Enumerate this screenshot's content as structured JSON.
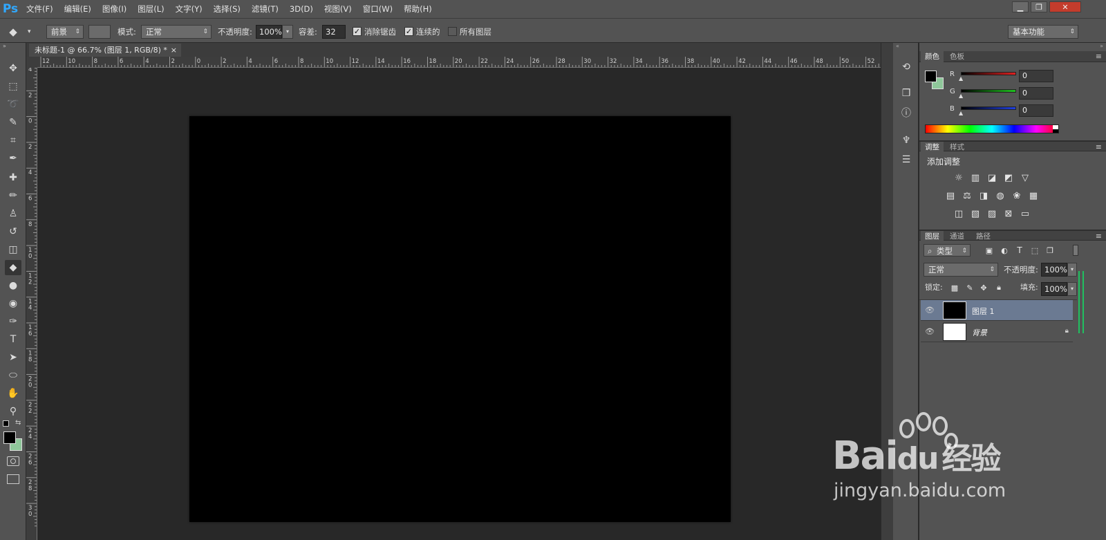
{
  "app": {
    "logo": "Ps"
  },
  "menu": [
    "文件(F)",
    "编辑(E)",
    "图像(I)",
    "图层(L)",
    "文字(Y)",
    "选择(S)",
    "滤镜(T)",
    "3D(D)",
    "视图(V)",
    "窗口(W)",
    "帮助(H)"
  ],
  "window_controls": {
    "minimize": "▁",
    "restore": "❐",
    "close": "✕"
  },
  "options": {
    "fill_source": "前景",
    "mode_label": "模式:",
    "mode_value": "正常",
    "opacity_label": "不透明度:",
    "opacity_value": "100%",
    "tolerance_label": "容差:",
    "tolerance_value": "32",
    "antialias_label": "消除锯齿",
    "contiguous_label": "连续的",
    "all_layers_label": "所有图层",
    "antialias_checked": true,
    "contiguous_checked": true,
    "all_layers_checked": false,
    "workspace": "基本功能"
  },
  "document": {
    "tab_title": "未标题-1 @ 66.7% (图层 1, RGB/8) *",
    "close": "×"
  },
  "ruler_h": [
    "12",
    "10",
    "8",
    "6",
    "4",
    "2",
    "0",
    "2",
    "4",
    "6",
    "8",
    "10",
    "12",
    "14",
    "16",
    "18",
    "20",
    "22",
    "24",
    "26",
    "28",
    "30",
    "32",
    "34",
    "36",
    "38",
    "40",
    "42",
    "44",
    "46",
    "48",
    "50",
    "52"
  ],
  "ruler_v": [
    "4",
    "2",
    "0",
    "2",
    "4",
    "6",
    "8",
    "1 0",
    "1 2",
    "1 4",
    "1 6",
    "1 8",
    "2 0",
    "2 2",
    "2 4",
    "2 6",
    "2 8",
    "3 0"
  ],
  "tools": [
    "move-tool",
    "marquee-tool",
    "lasso-tool",
    "quick-select-tool",
    "crop-tool",
    "eyedropper-tool",
    "healing-tool",
    "brush-tool",
    "stamp-tool",
    "history-brush-tool",
    "eraser-tool",
    "paint-bucket-tool",
    "blur-tool",
    "dodge-tool",
    "pen-tool",
    "type-tool",
    "path-select-tool",
    "ellipse-tool",
    "hand-tool",
    "zoom-tool"
  ],
  "colors": {
    "foreground": "#000000",
    "background": "#8fc79a",
    "accent": "#30a8ff"
  },
  "color_panel": {
    "tabs": [
      "颜色",
      "色板"
    ],
    "channels": [
      {
        "label": "R",
        "value": "0",
        "color": "#e02020"
      },
      {
        "label": "G",
        "value": "0",
        "color": "#20c020"
      },
      {
        "label": "B",
        "value": "0",
        "color": "#2040e0"
      }
    ]
  },
  "adjust_panel": {
    "tabs": [
      "调整",
      "样式"
    ],
    "title": "添加调整"
  },
  "layers_panel": {
    "tabs": [
      "图层",
      "通道",
      "路径"
    ],
    "filter_kind": "类型",
    "blend_mode": "正常",
    "opacity_label": "不透明度:",
    "opacity_value": "100%",
    "lock_label": "锁定:",
    "fill_label": "填充:",
    "fill_value": "100%",
    "layers": [
      {
        "name": "图层 1",
        "selected": true,
        "thumb": "#000000"
      },
      {
        "name": "背景",
        "selected": false,
        "thumb": "#ffffff",
        "locked": true
      }
    ]
  },
  "watermark": {
    "brand_main": "Bai",
    "brand_paw": "du",
    "brand_cn": "经验",
    "url": "jingyan.baidu.com"
  }
}
